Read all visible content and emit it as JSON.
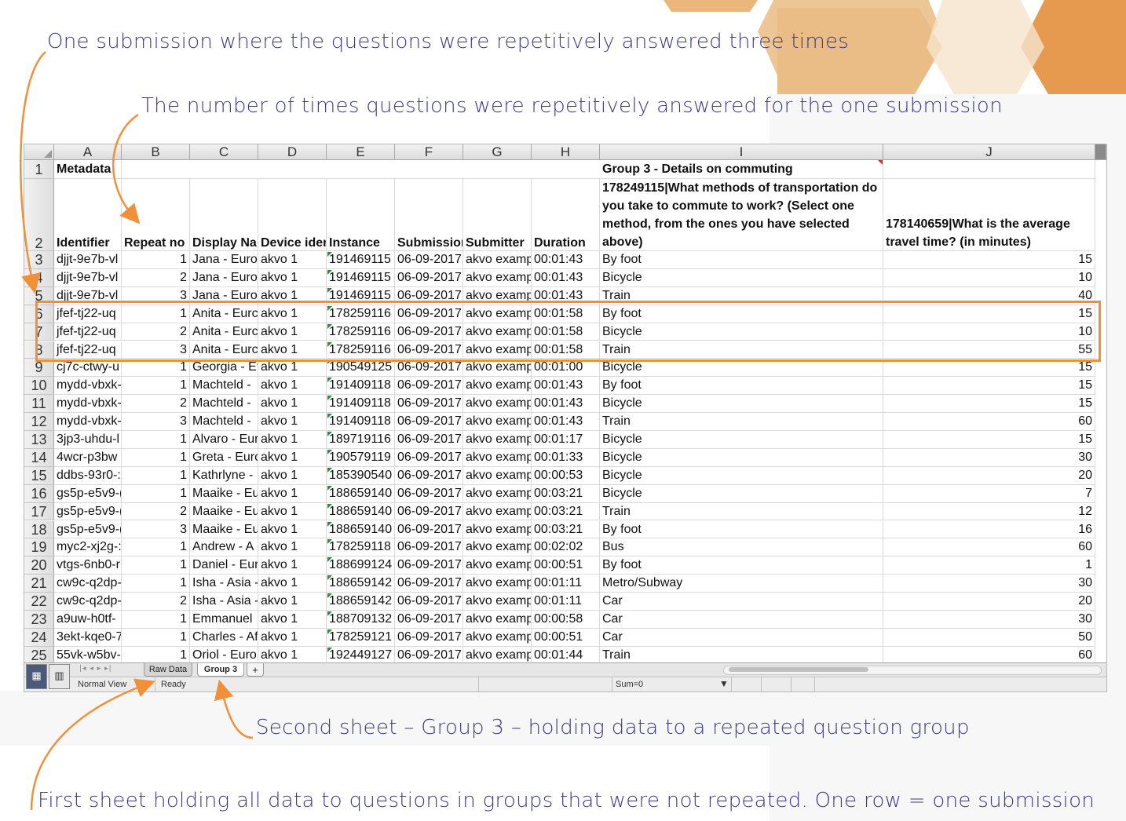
{
  "annotations": {
    "one_submission": "One submission where the questions were repetitively answered three times",
    "repeat_count": "The number of times questions were repetitively answered for the one submission",
    "second_sheet": "Second sheet – Group 3 – holding data to a repeated question group",
    "first_sheet": "First sheet holding all data to questions in groups that were not repeated. One row = one submission"
  },
  "columns": [
    "A",
    "B",
    "C",
    "D",
    "E",
    "F",
    "G",
    "H",
    "I",
    "J"
  ],
  "row1": {
    "metadata": "Metadata",
    "group": "Group 3 - Details on commuting"
  },
  "row2": {
    "identifier": "Identifier",
    "repeat_no": "Repeat no",
    "display_name": "Display Nar",
    "device": "Device ider",
    "instance": "Instance",
    "submission": "Submission",
    "submitter": "Submitter",
    "duration": "Duration",
    "q1": "178249115|What methods of transportation do you take to commute to work? (Select one method, from the ones you have selected above)",
    "q2": "178140659|What is the average travel time? (in minutes)"
  },
  "rows": [
    {
      "n": "3",
      "id": "djjt-9e7b-vl",
      "rep": "1",
      "name": "Jana - Euro|",
      "dev": "akvo 1",
      "inst": "191469115",
      "date": "06-09-2017",
      "sub": "akvo examp",
      "dur": "00:01:43",
      "method": "By foot",
      "time": "15"
    },
    {
      "n": "4",
      "id": "djjt-9e7b-vl",
      "rep": "2",
      "name": "Jana - Euro|",
      "dev": "akvo 1",
      "inst": "191469115",
      "date": "06-09-2017",
      "sub": "akvo examp",
      "dur": "00:01:43",
      "method": "Bicycle",
      "time": "10"
    },
    {
      "n": "5",
      "id": "djjt-9e7b-vl",
      "rep": "3",
      "name": "Jana - Euro|",
      "dev": "akvo 1",
      "inst": "191469115",
      "date": "06-09-2017",
      "sub": "akvo examp",
      "dur": "00:01:43",
      "method": "Train",
      "time": "40"
    },
    {
      "n": "6",
      "id": "jfef-tj22-uq",
      "rep": "1",
      "name": "Anita - Eurc",
      "dev": "akvo 1",
      "inst": "178259116",
      "date": "06-09-2017",
      "sub": "akvo examp",
      "dur": "00:01:58",
      "method": "By foot",
      "time": "15"
    },
    {
      "n": "7",
      "id": "jfef-tj22-uq",
      "rep": "2",
      "name": "Anita - Eurc",
      "dev": "akvo 1",
      "inst": "178259116",
      "date": "06-09-2017",
      "sub": "akvo examp",
      "dur": "00:01:58",
      "method": "Bicycle",
      "time": "10"
    },
    {
      "n": "8",
      "id": "jfef-tj22-uq",
      "rep": "3",
      "name": "Anita - Eurc",
      "dev": "akvo 1",
      "inst": "178259116",
      "date": "06-09-2017",
      "sub": "akvo examp",
      "dur": "00:01:58",
      "method": "Train",
      "time": "55"
    },
    {
      "n": "9",
      "id": "cj7c-ctwy-u",
      "rep": "1",
      "name": "Georgia - Et",
      "dev": "akvo 1",
      "inst": "190549125",
      "date": "06-09-2017",
      "sub": "akvo examp",
      "dur": "00:01:00",
      "method": "Bicycle",
      "time": "15"
    },
    {
      "n": "10",
      "id": "mydd-vbxk-",
      "rep": "1",
      "name": "Machteld -",
      "dev": "akvo 1",
      "inst": "191409118",
      "date": "06-09-2017",
      "sub": "akvo examp",
      "dur": "00:01:43",
      "method": "By foot",
      "time": "15"
    },
    {
      "n": "11",
      "id": "mydd-vbxk-",
      "rep": "2",
      "name": "Machteld -",
      "dev": "akvo 1",
      "inst": "191409118",
      "date": "06-09-2017",
      "sub": "akvo examp",
      "dur": "00:01:43",
      "method": "Bicycle",
      "time": "15"
    },
    {
      "n": "12",
      "id": "mydd-vbxk-",
      "rep": "3",
      "name": "Machteld -",
      "dev": "akvo 1",
      "inst": "191409118",
      "date": "06-09-2017",
      "sub": "akvo examp",
      "dur": "00:01:43",
      "method": "Train",
      "time": "60"
    },
    {
      "n": "13",
      "id": "3jp3-uhdu-l",
      "rep": "1",
      "name": "Alvaro - Eur",
      "dev": "akvo 1",
      "inst": "189719116",
      "date": "06-09-2017",
      "sub": "akvo examp",
      "dur": "00:01:17",
      "method": "Bicycle",
      "time": "15"
    },
    {
      "n": "14",
      "id": "4wcr-p3bw",
      "rep": "1",
      "name": "Greta - Eurc",
      "dev": "akvo 1",
      "inst": "190579119",
      "date": "06-09-2017",
      "sub": "akvo examp",
      "dur": "00:01:33",
      "method": "Bicycle",
      "time": "30"
    },
    {
      "n": "15",
      "id": "ddbs-93r0-:",
      "rep": "1",
      "name": "Kathrlyne -",
      "dev": "akvo 1",
      "inst": "185390540",
      "date": "06-09-2017",
      "sub": "akvo examp",
      "dur": "00:00:53",
      "method": "Bicycle",
      "time": "20"
    },
    {
      "n": "16",
      "id": "gs5p-e5v9-(",
      "rep": "1",
      "name": "Maaike - Eu",
      "dev": "akvo 1",
      "inst": "188659140",
      "date": "06-09-2017",
      "sub": "akvo examp",
      "dur": "00:03:21",
      "method": "Bicycle",
      "time": "7"
    },
    {
      "n": "17",
      "id": "gs5p-e5v9-(",
      "rep": "2",
      "name": "Maaike - Eu",
      "dev": "akvo 1",
      "inst": "188659140",
      "date": "06-09-2017",
      "sub": "akvo examp",
      "dur": "00:03:21",
      "method": "Train",
      "time": "12"
    },
    {
      "n": "18",
      "id": "gs5p-e5v9-(",
      "rep": "3",
      "name": "Maaike - Eu",
      "dev": "akvo 1",
      "inst": "188659140",
      "date": "06-09-2017",
      "sub": "akvo examp",
      "dur": "00:03:21",
      "method": "By foot",
      "time": "16"
    },
    {
      "n": "19",
      "id": "myc2-xj2g-:",
      "rep": "1",
      "name": "Andrew - A",
      "dev": "akvo 1",
      "inst": "178259118",
      "date": "06-09-2017",
      "sub": "akvo examp",
      "dur": "00:02:02",
      "method": "Bus",
      "time": "60"
    },
    {
      "n": "20",
      "id": "vtgs-6nb0-r",
      "rep": "1",
      "name": "Daniel - Eur",
      "dev": "akvo 1",
      "inst": "188699124",
      "date": "06-09-2017",
      "sub": "akvo examp",
      "dur": "00:00:51",
      "method": "By foot",
      "time": "1"
    },
    {
      "n": "21",
      "id": "cw9c-q2dp-",
      "rep": "1",
      "name": "Isha - Asia -",
      "dev": "akvo 1",
      "inst": "188659142",
      "date": "06-09-2017",
      "sub": "akvo examp",
      "dur": "00:01:11",
      "method": "Metro/Subway",
      "time": "30"
    },
    {
      "n": "22",
      "id": "cw9c-q2dp-",
      "rep": "2",
      "name": "Isha - Asia -",
      "dev": "akvo 1",
      "inst": "188659142",
      "date": "06-09-2017",
      "sub": "akvo examp",
      "dur": "00:01:11",
      "method": "Car",
      "time": "20"
    },
    {
      "n": "23",
      "id": "a9uw-h0tf-",
      "rep": "1",
      "name": "Emmanuel",
      "dev": "akvo 1",
      "inst": "188709132",
      "date": "06-09-2017",
      "sub": "akvo examp",
      "dur": "00:00:58",
      "method": "Car",
      "time": "30"
    },
    {
      "n": "24",
      "id": "3ekt-kqe0-7",
      "rep": "1",
      "name": "Charles - Af",
      "dev": "akvo 1",
      "inst": "178259121",
      "date": "06-09-2017",
      "sub": "akvo examp",
      "dur": "00:00:51",
      "method": "Car",
      "time": "50"
    },
    {
      "n": "25",
      "id": "55vk-w5bv-",
      "rep": "1",
      "name": "Oriol - Euro",
      "dev": "akvo 1",
      "inst": "192449127",
      "date": "06-09-2017",
      "sub": "akvo examp",
      "dur": "00:01:44",
      "method": "Train",
      "time": "60"
    }
  ],
  "tabs": {
    "raw": "Raw Data",
    "group3": "Group 3",
    "add": "+"
  },
  "status": {
    "view": "Normal View",
    "ready": "Ready",
    "sum": "Sum=0"
  },
  "colors": {
    "accent": "#f0913a",
    "annotation_text": "#3d3a8c"
  }
}
